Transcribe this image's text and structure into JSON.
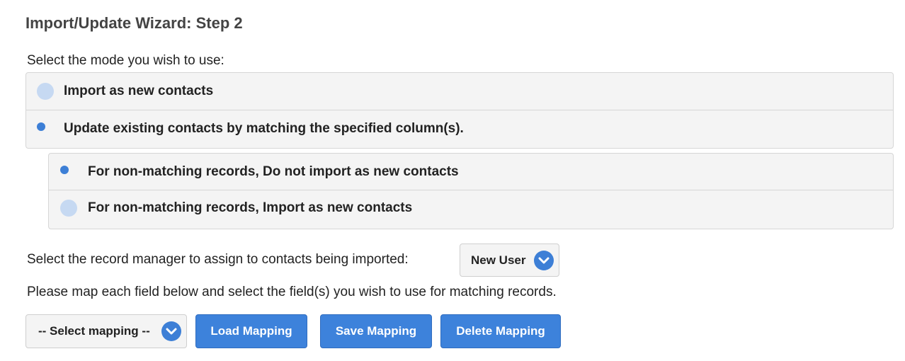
{
  "wizard": {
    "title": "Import/Update Wizard: Step 2",
    "mode_prompt": "Select the mode you wish to use:",
    "modes": [
      {
        "label": "Import as new contacts",
        "selected": false
      },
      {
        "label": "Update existing contacts by matching the specified column(s).",
        "selected": true
      }
    ],
    "non_matching_options": [
      {
        "label": "For non-matching records, Do not import as new contacts",
        "selected": true
      },
      {
        "label": "For non-matching records, Import as new contacts",
        "selected": false
      }
    ],
    "record_manager": {
      "label": "Select the record manager to assign to contacts being imported:",
      "selected_value": "New User",
      "icon": "chevron-down-icon"
    },
    "map_instructions": "Please map each field below and select the field(s) you wish to use for matching records.",
    "mapping": {
      "select_value": "-- Select mapping --",
      "load_label": "Load Mapping",
      "save_label": "Save Mapping",
      "delete_label": "Delete Mapping"
    },
    "colors": {
      "accent": "#3d82db",
      "radio_on": "#3d7fd6",
      "radio_off": "#c6d9f2",
      "panel": "#f4f4f4"
    }
  }
}
